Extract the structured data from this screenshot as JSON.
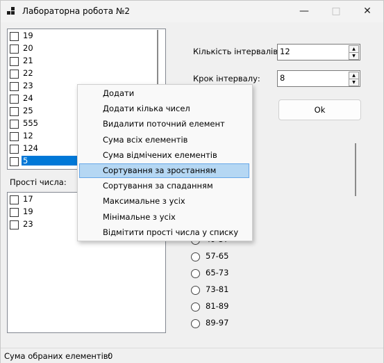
{
  "window": {
    "title": "Лабораторна робота №2"
  },
  "numbers_list": {
    "items": [
      {
        "label": "19",
        "checked": false
      },
      {
        "label": "20",
        "checked": false
      },
      {
        "label": "21",
        "checked": false
      },
      {
        "label": "22",
        "checked": false
      },
      {
        "label": "23",
        "checked": false
      },
      {
        "label": "24",
        "checked": false
      },
      {
        "label": "25",
        "checked": false
      },
      {
        "label": "555",
        "checked": false
      },
      {
        "label": "12",
        "checked": false
      },
      {
        "label": "124",
        "checked": false
      },
      {
        "label": "5",
        "checked": false,
        "selected": true
      }
    ]
  },
  "primes": {
    "label": "Прості числа:",
    "items": [
      {
        "label": "17",
        "checked": false
      },
      {
        "label": "19",
        "checked": false
      },
      {
        "label": "23",
        "checked": false
      }
    ]
  },
  "settings": {
    "intervals_label": "Кількість інтервалів:",
    "intervals_value": "12",
    "step_label": "Крок інтервалу:",
    "step_value": "8",
    "ok_label": "Ok"
  },
  "ranges": [
    "49-57",
    "57-65",
    "65-73",
    "73-81",
    "81-89",
    "89-97"
  ],
  "context_menu": {
    "highlighted_index": 5,
    "items": [
      "Додати",
      "Додати кілька чисел",
      "Видалити поточний елемент",
      "Сума всіх елементів",
      "Сума відмічених елементів",
      "Сортування за зростанням",
      "Сортування за спаданням",
      "Максимальне з усіх",
      "Мінімальне з усіх",
      "Відмітити прості числа у списку"
    ]
  },
  "status": {
    "label": "Сума обраних елементів:",
    "value": "0"
  }
}
